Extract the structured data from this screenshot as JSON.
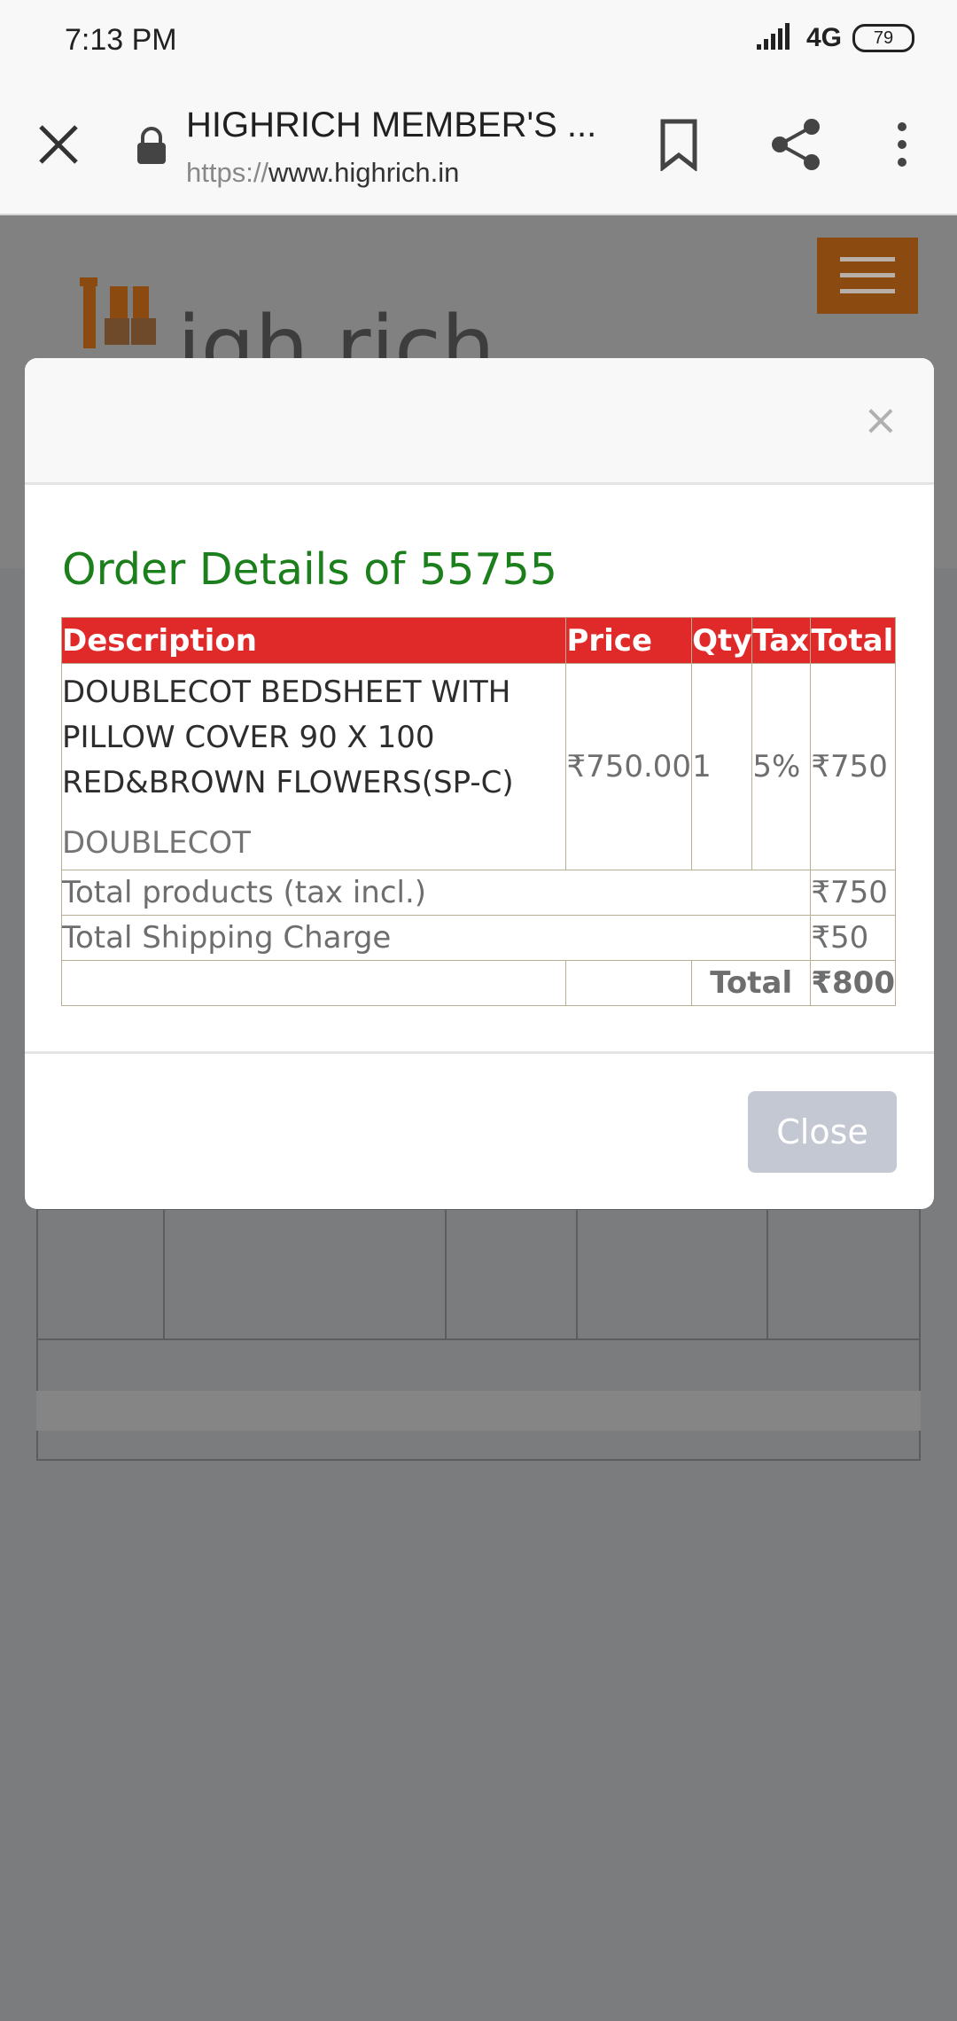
{
  "status_bar": {
    "time": "7:13 PM",
    "network": "4G",
    "battery": "79"
  },
  "browser": {
    "title": "HIGHRICH MEMBER'S ...",
    "url_protocol": "https://",
    "url_host": "www.highrich.in"
  },
  "background_page": {
    "logo_text": "igh rich"
  },
  "modal": {
    "close_x": "×",
    "title": "Order Details of 55755",
    "table": {
      "headers": [
        "Description",
        "Price",
        "Qty",
        "Tax",
        "Total"
      ],
      "item": {
        "name": "DOUBLECOT BEDSHEET WITH PILLOW COVER 90 X 100 RED&BROWN FLOWERS(SP-C)",
        "category": "DOUBLECOT",
        "price": "₹750.00",
        "qty": "1",
        "tax": "5%",
        "total": "₹750"
      },
      "total_products_label": "Total products (tax incl.)",
      "total_products_value": "₹750",
      "shipping_label": "Total Shipping Charge",
      "shipping_value": "₹50",
      "grand_total_label": "Total",
      "grand_total_value": "₹800"
    },
    "close_button": "Close"
  },
  "colors": {
    "header_red": "#e02a2a",
    "title_green": "#1b7f1b",
    "close_button": "#c3c8d3",
    "hamburger": "#8a4a10"
  }
}
